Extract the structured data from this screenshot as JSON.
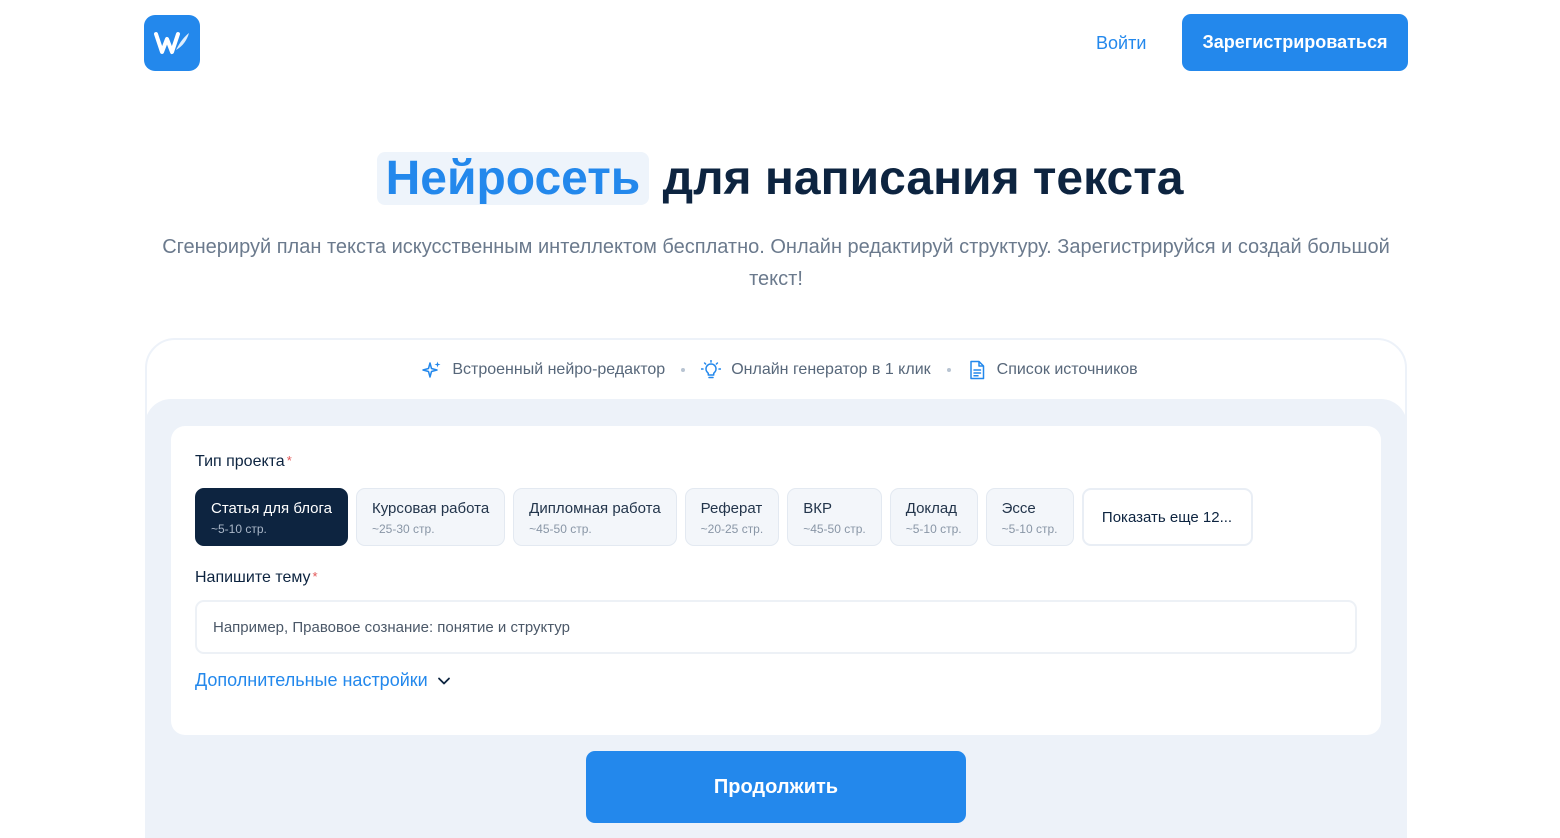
{
  "header": {
    "logo_letter": "W",
    "login_label": "Войти",
    "register_label": "Зарегистрироваться"
  },
  "hero": {
    "title_highlight": "Нейросеть",
    "title_rest": "для написания текста",
    "subtitle": "Сгенерируй план текста искусственным интеллектом бесплатно. Онлайн редактируй структуру. Зарегистрируйся и создай большой текст!"
  },
  "features": [
    {
      "icon": "sparkles-icon",
      "label": "Встроенный нейро-редактор"
    },
    {
      "icon": "lightbulb-icon",
      "label": "Онлайн генератор в 1 клик"
    },
    {
      "icon": "document-icon",
      "label": "Список источников"
    }
  ],
  "form": {
    "type_label": "Тип проекта",
    "required_mark": "*",
    "types": [
      {
        "name": "Статья для блога",
        "pages": "~5-10 стр.",
        "selected": true
      },
      {
        "name": "Курсовая работа",
        "pages": "~25-30 стр.",
        "selected": false
      },
      {
        "name": "Дипломная работа",
        "pages": "~45-50 стр.",
        "selected": false
      },
      {
        "name": "Реферат",
        "pages": "~20-25 стр.",
        "selected": false
      },
      {
        "name": "ВКР",
        "pages": "~45-50 стр.",
        "selected": false
      },
      {
        "name": "Доклад",
        "pages": "~5-10 стр.",
        "selected": false
      },
      {
        "name": "Эссе",
        "pages": "~5-10 стр.",
        "selected": false
      }
    ],
    "show_more_label": "Показать еще 12...",
    "topic_label": "Напишите тему",
    "topic_placeholder": "Например, Правовое сознание: понятие и структур",
    "topic_value": "",
    "advanced_label": "Дополнительные настройки",
    "continue_label": "Продолжить"
  },
  "colors": {
    "accent": "#2388ec",
    "dark": "#0d2440",
    "panel_bg": "#edf2f9"
  }
}
